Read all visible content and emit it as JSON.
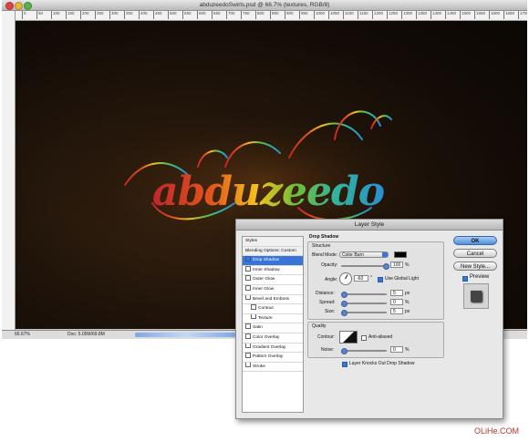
{
  "document": {
    "title": "abduzeedoSwirls.psd @ 66.7% (textures, RGB/8)",
    "ruler_ticks": [
      "0",
      "50",
      "100",
      "150",
      "200",
      "250",
      "300",
      "350",
      "400",
      "450",
      "500",
      "550",
      "600",
      "650",
      "700",
      "750",
      "800",
      "850",
      "900",
      "950",
      "1000",
      "1050",
      "1100",
      "1150",
      "1200",
      "1250",
      "1300",
      "1350",
      "1400",
      "1450",
      "1500",
      "1550",
      "1600",
      "1650",
      "1700"
    ],
    "artwork_text": "abduzeedo",
    "status": {
      "zoom": "66.67%",
      "doc_size": "Doc: 5.05M/69.8M"
    }
  },
  "dialog": {
    "title": "Layer Style",
    "styles_list": [
      {
        "label": "Styles",
        "checkbox": false,
        "selected": false,
        "header": true
      },
      {
        "label": "Blending Options: Custom",
        "checkbox": false,
        "selected": false,
        "header": true
      },
      {
        "label": "Drop Shadow",
        "checkbox": true,
        "checked": true,
        "selected": true
      },
      {
        "label": "Inner Shadow",
        "checkbox": true,
        "checked": false
      },
      {
        "label": "Outer Glow",
        "checkbox": true,
        "checked": false
      },
      {
        "label": "Inner Glow",
        "checkbox": true,
        "checked": false
      },
      {
        "label": "Bevel and Emboss",
        "checkbox": true,
        "checked": false
      },
      {
        "label": "Contour",
        "checkbox": true,
        "checked": false,
        "indent": true
      },
      {
        "label": "Texture",
        "checkbox": true,
        "checked": false,
        "indent": true
      },
      {
        "label": "Satin",
        "checkbox": true,
        "checked": false
      },
      {
        "label": "Color Overlay",
        "checkbox": true,
        "checked": false
      },
      {
        "label": "Gradient Overlay",
        "checkbox": true,
        "checked": false
      },
      {
        "label": "Pattern Overlay",
        "checkbox": true,
        "checked": false
      },
      {
        "label": "Stroke",
        "checkbox": true,
        "checked": false
      }
    ],
    "section_title": "Drop Shadow",
    "structure_label": "Structure",
    "blend_mode_label": "Blend Mode:",
    "blend_mode_value": "Color Burn",
    "opacity_label": "Opacity:",
    "opacity_value": "100",
    "opacity_unit": "%",
    "angle_label": "Angle:",
    "angle_value": "-60",
    "angle_unit": "°",
    "use_global_light_label": "Use Global Light",
    "distance_label": "Distance:",
    "distance_value": "5",
    "distance_unit": "px",
    "spread_label": "Spread:",
    "spread_value": "0",
    "spread_unit": "%",
    "size_label": "Size:",
    "size_value": "5",
    "size_unit": "px",
    "quality_label": "Quality",
    "contour_label": "Contour:",
    "anti_aliased_label": "Anti-aliased",
    "noise_label": "Noise:",
    "noise_value": "0",
    "noise_unit": "%",
    "knockout_label": "Layer Knocks Out Drop Shadow",
    "buttons": {
      "ok": "OK",
      "cancel": "Cancel",
      "new_style": "New Style..."
    },
    "preview_label": "Preview"
  },
  "watermark": "OLiHe.COM"
}
